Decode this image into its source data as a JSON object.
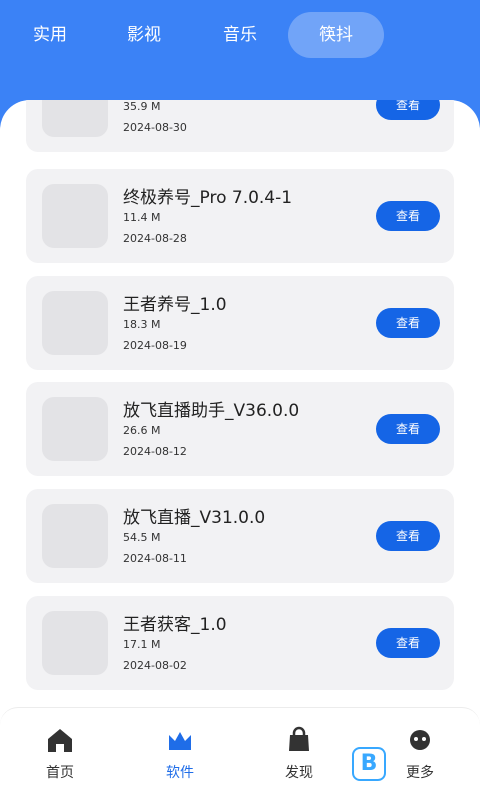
{
  "tabs": [
    "实用",
    "影视",
    "音乐",
    "筷抖"
  ],
  "items": [
    {
      "name": "",
      "size": "35.9 M",
      "date": "2024-08-30",
      "button": "查看"
    },
    {
      "name": "终极养号_Pro 7.0.4-1",
      "size": "11.4 M",
      "date": "2024-08-28",
      "button": "查看"
    },
    {
      "name": "王者养号_1.0",
      "size": "18.3 M",
      "date": "2024-08-19",
      "button": "查看"
    },
    {
      "name": "放飞直播助手_V36.0.0",
      "size": "26.6 M",
      "date": "2024-08-12",
      "button": "查看"
    },
    {
      "name": "放飞直播_V31.0.0",
      "size": "54.5 M",
      "date": "2024-08-11",
      "button": "查看"
    },
    {
      "name": "王者获客_1.0",
      "size": "17.1 M",
      "date": "2024-08-02",
      "button": "查看"
    }
  ],
  "bottom_nav": [
    {
      "label": "首页",
      "icon": "home-icon"
    },
    {
      "label": "软件",
      "icon": "software-icon",
      "active": true
    },
    {
      "label": "发现",
      "icon": "shopping-bag-icon"
    },
    {
      "label": "更多",
      "icon": "more-icon"
    }
  ],
  "watermark": "B",
  "colors": {
    "accent": "#3b82f6",
    "button": "#1565e6",
    "active_nav": "#1f6de8"
  }
}
